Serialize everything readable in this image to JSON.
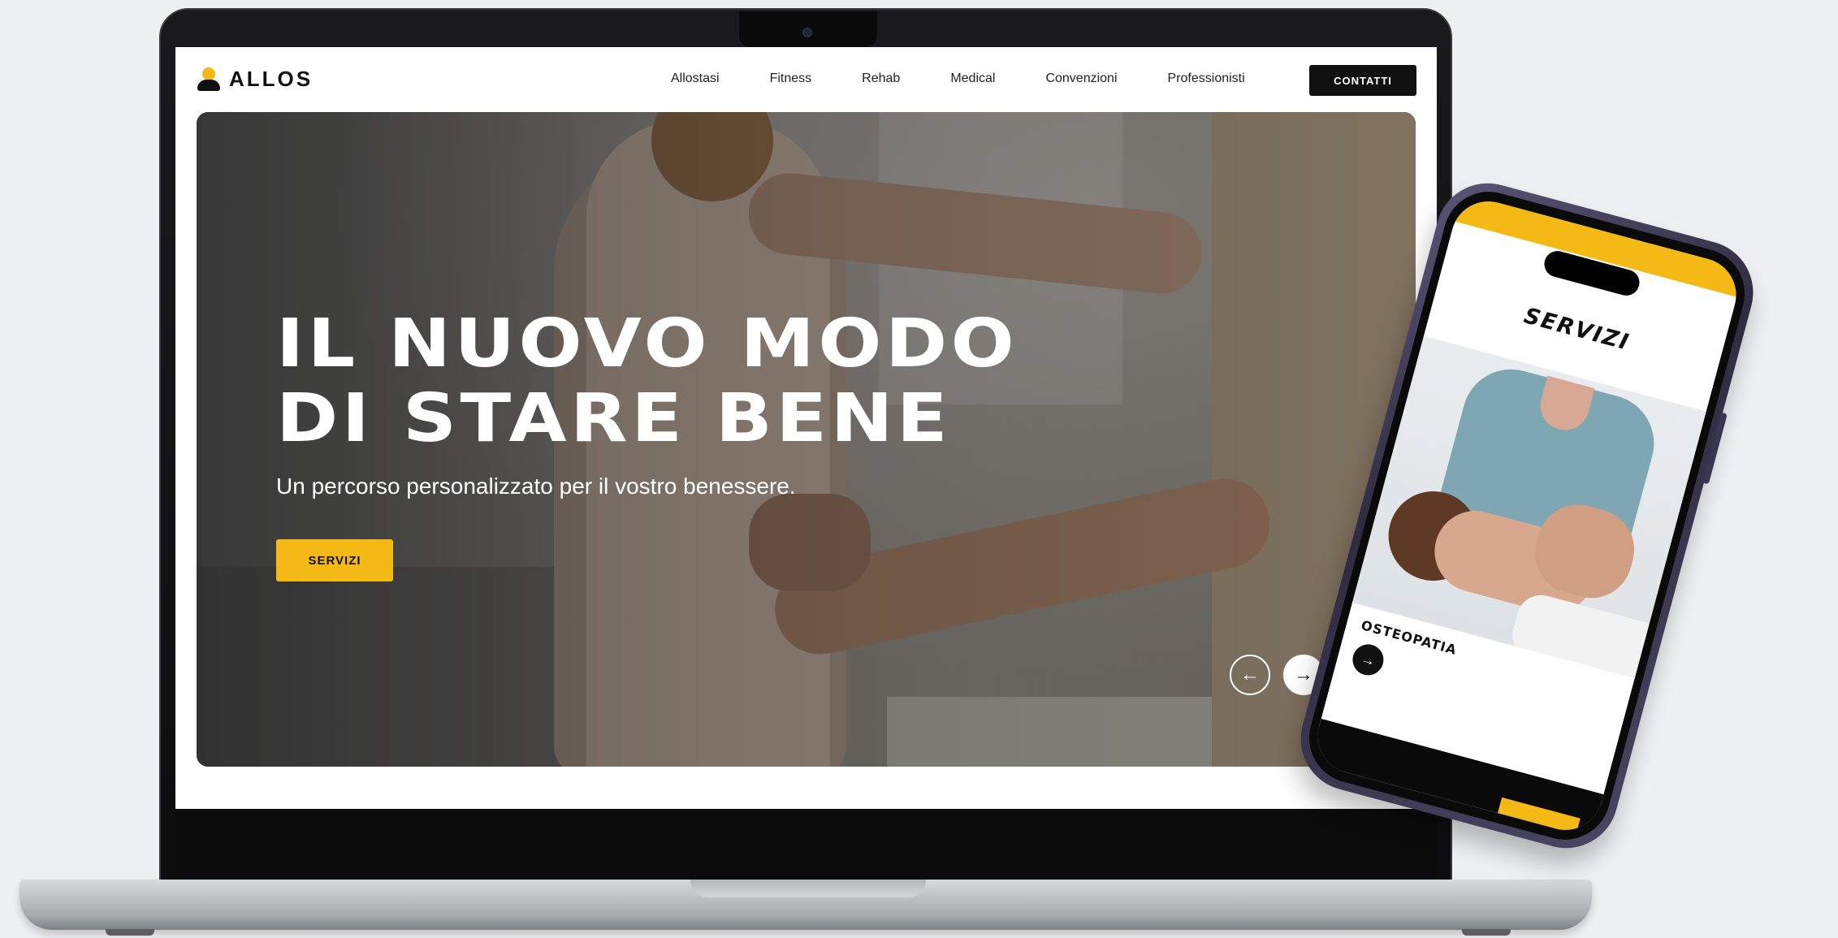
{
  "website": {
    "logo_text": "ALLOS",
    "nav": {
      "items": [
        "Allostasi",
        "Fitness",
        "Rehab",
        "Medical",
        "Convenzioni",
        "Professionisti"
      ],
      "cta_label": "CONTATTI"
    },
    "hero": {
      "title_line1": "IL NUOVO MODO",
      "title_line2": "DI STARE BENE",
      "subtitle": "Un percorso personalizzato per il vostro benessere.",
      "button_label": "SERVIZI",
      "prev_arrow": "←",
      "next_arrow": "→"
    }
  },
  "mobile": {
    "section_title": "SERVIZI",
    "card_label": "OSTEOPATIA",
    "card_arrow": "→"
  },
  "colors": {
    "accent": "#f5b916",
    "dark": "#111111",
    "background": "#eef0f2"
  },
  "icons": {
    "logo": "person-logo-icon",
    "prev": "arrow-left-icon",
    "next": "arrow-right-icon"
  }
}
